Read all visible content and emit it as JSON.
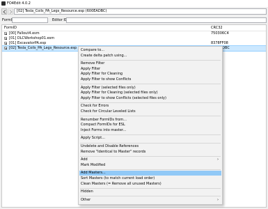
{
  "window": {
    "title": "FO4Edit 4.0.2"
  },
  "toolbar": {
    "path": "[02] Tesla_Coils_PA_Legs_Resource.esp (600EADBC)"
  },
  "search": {
    "formid_label": "FormID",
    "editorid_label": "Editor ID",
    "formid_value": "",
    "editorid_value": ""
  },
  "tree": {
    "columns": [
      "FormID",
      "CRC32"
    ],
    "rows": [
      {
        "name": "[00] Fallout4.esm",
        "crc": "750306C4",
        "selected": false
      },
      {
        "name": "[01] DLCWorkshop01.esm",
        "crc": "",
        "selected": false
      },
      {
        "name": "[01] ExcavatorPA.esp",
        "crc": "8378FF08",
        "selected": false
      },
      {
        "name": "[02] Tesla_Coils_PA_Legs_Resource.esp",
        "crc": "600EADBC",
        "selected": true
      }
    ]
  },
  "menu": {
    "groups": [
      [
        "Compare to...",
        "Create delta patch using..."
      ],
      [
        "Remove Filter",
        "Apply Filter",
        "Apply Filter for Cleaning",
        "Apply Filter to show Conflicts"
      ],
      [
        "Apply Filter (selected files only)",
        "Apply Filter for Cleaning (selected files only)",
        "Apply Filter to show Conflicts (selected files only)"
      ],
      [
        "Check for Errors",
        "Check for Circular Leveled Lists"
      ],
      [
        "Renumber FormIDs from...",
        "Compact FormIDs for ESL",
        "Inject Forms into master..."
      ],
      [
        "Apply Script..."
      ],
      [
        "Undelete and Disable References",
        "Remove \"Identical to Master\" records"
      ],
      [
        "Add",
        "Mark Modified"
      ],
      [
        "Add Masters...",
        "Sort Masters (to match current load order)",
        "Clean Masters (= Remove all unused Masters)"
      ],
      [
        "Hidden"
      ],
      [
        "Other"
      ]
    ],
    "highlighted": "Add Masters...",
    "submenu_items": [
      "Add",
      "Other"
    ]
  }
}
